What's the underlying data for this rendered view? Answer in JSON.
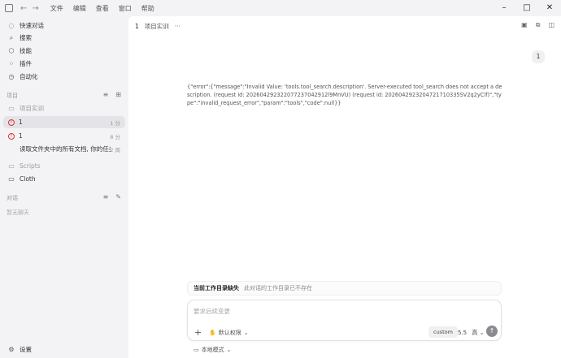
{
  "titlebar": {
    "back_icon": "arrow-left-icon",
    "forward_icon": "arrow-right-icon",
    "menu": [
      "文件",
      "编辑",
      "查看",
      "窗口",
      "帮助"
    ]
  },
  "sidebar": {
    "nav": [
      {
        "label": "快速对话",
        "icon": "chat-icon"
      },
      {
        "label": "搜索",
        "icon": "search-icon"
      },
      {
        "label": "技能",
        "icon": "skill-icon"
      },
      {
        "label": "插件",
        "icon": "plugin-icon"
      },
      {
        "label": "自动化",
        "icon": "clock-icon"
      }
    ],
    "projects_title": "项目",
    "projects": [
      {
        "label": "项目实训"
      }
    ],
    "threads": [
      {
        "label": "1",
        "meta": "1 分"
      },
      {
        "label": "1",
        "meta": "8 分"
      },
      {
        "label": "读取文件夹中的所有文档, 你的任务...",
        "meta": "2 周"
      }
    ],
    "folders": [
      {
        "label": "Scripts"
      },
      {
        "label": "Cloth"
      }
    ],
    "chats_title": "对话",
    "chats_empty": "暂无聊天",
    "settings_label": "设置"
  },
  "main": {
    "tab_number": "1",
    "tab_title": "项目实训",
    "tab_more": "···",
    "user_message": "1",
    "error_message": "{\"error\":{\"message\":\"Invalid Value: 'tools.tool_search.description'. Server-executed tool_search does not accept a description. (request id: 202604292322077237042912l9MnVU) (request id: 2026042923204721710335SV2q2yClf)\",\"type\":\"invalid_request_error\",\"param\":\"tools\",\"code\":null}}",
    "warning_title": "当前工作目录缺失",
    "warning_text": "此对话的工作目录已不存在",
    "composer_placeholder": "要求后续变更",
    "permission_label": "默认权限",
    "custom_label": "custom",
    "model_label": "5.5",
    "effort_label": "高",
    "local_mode_label": "本地模式"
  }
}
